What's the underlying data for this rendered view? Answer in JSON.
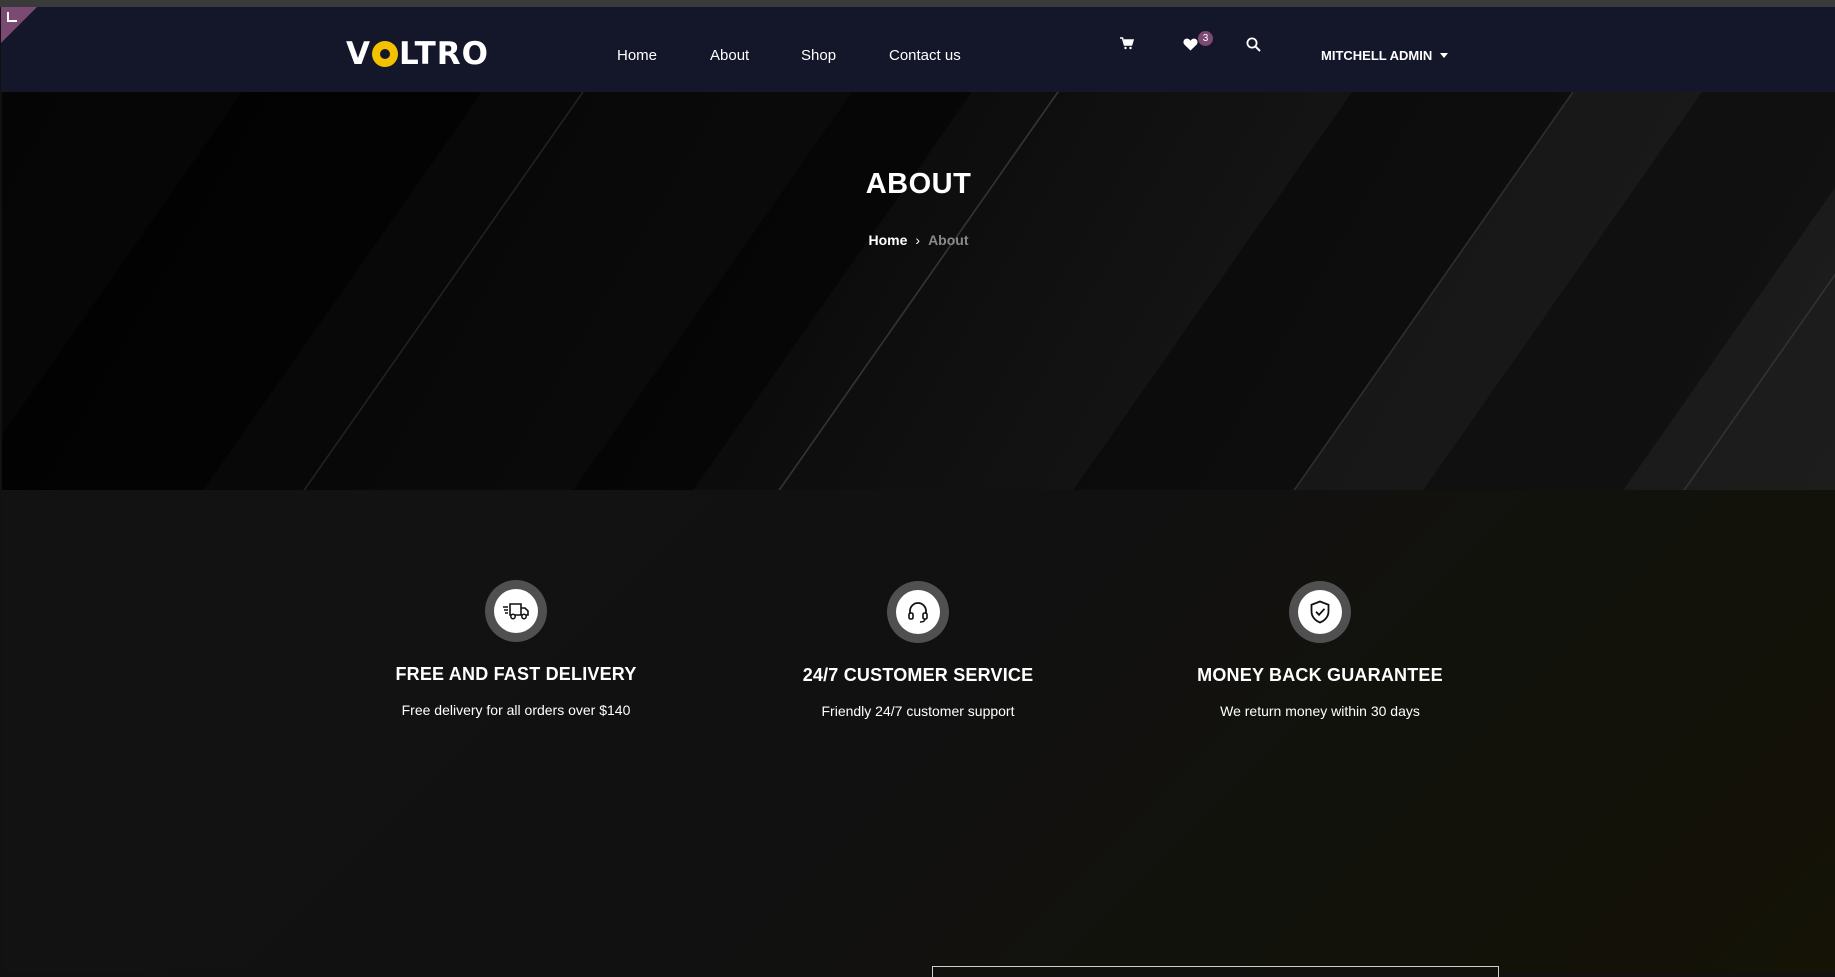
{
  "brand": {
    "logo_pre": "V",
    "logo_post": "LTRO",
    "accent_color": "#f2c200",
    "badge_color": "#7a4a72"
  },
  "nav": {
    "items": [
      {
        "label": "Home"
      },
      {
        "label": "About"
      },
      {
        "label": "Shop"
      },
      {
        "label": "Contact us"
      }
    ]
  },
  "header_icons": {
    "cart_icon": "cart-icon",
    "wishlist_icon": "heart-icon",
    "wishlist_count": "3",
    "search_icon": "search-icon"
  },
  "user": {
    "name": "MITCHELL ADMIN"
  },
  "hero": {
    "title": "ABOUT",
    "breadcrumb": {
      "home": "Home",
      "separator": "›",
      "current": "About"
    }
  },
  "features": [
    {
      "icon": "delivery-truck-icon",
      "title": "FREE AND FAST DELIVERY",
      "text": "Free delivery for all orders over $140"
    },
    {
      "icon": "headset-icon",
      "title": "24/7 CUSTOMER SERVICE",
      "text": "Friendly 24/7 customer support"
    },
    {
      "icon": "shield-check-icon",
      "title": "MONEY BACK GUARANTEE",
      "text": "We return money within 30 days"
    }
  ]
}
